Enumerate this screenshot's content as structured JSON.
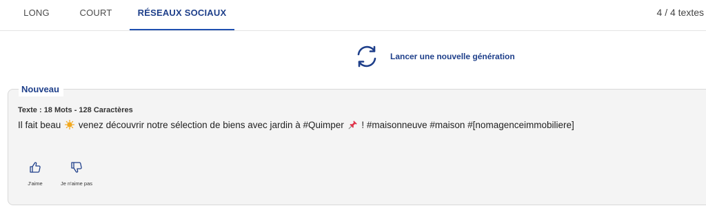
{
  "tabs": [
    {
      "label": "LONG",
      "active": false
    },
    {
      "label": "COURT",
      "active": false
    },
    {
      "label": "RÉSEAUX SOCIAUX",
      "active": true
    }
  ],
  "text_count": "4 / 4 textes",
  "regenerate": {
    "label": "Lancer une nouvelle génération",
    "icon": "refresh-icon"
  },
  "card": {
    "badge": "Nouveau",
    "meta": "Texte : 18 Mots - 128 Caractères",
    "text_part1": "Il fait beau",
    "text_part2": "venez découvrir notre sélection de biens avec jardin à #Quimper",
    "text_part3": "! #maisonneuve #maison #[nomagenceimmobiliere]",
    "emojis": [
      "sun-emoji",
      "pushpin-emoji"
    ],
    "like_label": "J'aime",
    "dislike_label": "Je n'aime pas"
  },
  "colors": {
    "accent": "#1e3f8a",
    "tab_underline": "#1e4fb0",
    "card_bg": "#f4f4f4",
    "sun": "#f2a81d",
    "pin": "#e0344b"
  }
}
